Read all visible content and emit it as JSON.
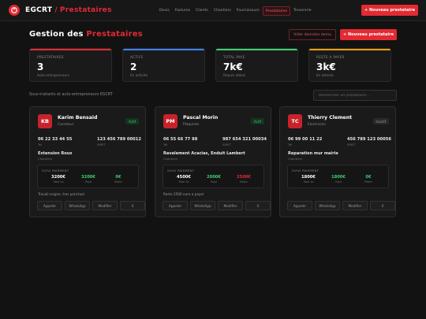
{
  "brand": {
    "name": "EGCRT",
    "separator": "/",
    "section": "Prestataires"
  },
  "nav": [
    {
      "label": "Devis",
      "active": false
    },
    {
      "label": "Factures",
      "active": false
    },
    {
      "label": "Clients",
      "active": false
    },
    {
      "label": "Chantiers",
      "active": false
    },
    {
      "label": "Fournisseurs",
      "active": false
    },
    {
      "label": "Prestataires",
      "active": true
    },
    {
      "label": "Tresorerie",
      "active": false
    }
  ],
  "topbar": {
    "new_button": "+ Nouveau prestataire"
  },
  "header": {
    "title_part1": "Gestion des",
    "title_part2": "Prestataires",
    "demo_button": "Vider données demo",
    "new_button": "+ Nouveau prestataire"
  },
  "stats": [
    {
      "label": "PRESTATAIRES",
      "value": "3",
      "sub": "Auto-entrepreneurs",
      "color": "#e32a32"
    },
    {
      "label": "ACTIFS",
      "value": "2",
      "sub": "En activite",
      "color": "#3b82f6"
    },
    {
      "label": "TOTAL PAYE",
      "value": "7k€",
      "sub": "Depuis debut",
      "color": "#3ecf6f"
    },
    {
      "label": "RESTE A PAYER",
      "value": "3k€",
      "sub": "En attente",
      "color": "#f59e0b"
    }
  ],
  "section": {
    "label": "Sous-traitants et auto-entrepreneurs EGCRT"
  },
  "search": {
    "placeholder": "Rechercher un prestataire..."
  },
  "cards": [
    {
      "initials": "KB",
      "name": "Karim Bensaid",
      "trade": "Carreleur",
      "status": "Actif",
      "status_class": "actif",
      "phone": "06 22 33 44 55",
      "phone_label": "Tel",
      "siret": "123 456 789 00012",
      "siret_label": "SIRET",
      "site": "Extension Roux",
      "site_label": "Chantiers",
      "pay_title": "SUIVI PAIEMENT",
      "total": "3200€",
      "paid": "3200€",
      "rest": "0€",
      "total_label": "Total du",
      "paid_label": "Paye",
      "rest_label": "Reste",
      "note": "Travail soigne, tres ponctuel",
      "actions": [
        "Appeler",
        "WhatsApp",
        "Modifier",
        "X"
      ]
    },
    {
      "initials": "PM",
      "name": "Pascal Morin",
      "trade": "Plaquiste",
      "status": "Actif",
      "status_class": "actif",
      "phone": "06 55 66 77 88",
      "phone_label": "Tel",
      "siret": "987 654 321 00034",
      "siret_label": "SIRET",
      "site": "Ravalement Acacias, Enduit Lambert",
      "site_label": "Chantiers",
      "pay_title": "SUIVI PAIEMENT",
      "total": "4500€",
      "paid": "2000€",
      "rest": "2500€",
      "total_label": "Total du",
      "paid_label": "Paye",
      "rest_label": "Reste",
      "note": "Reste 2500 euro a payer",
      "actions": [
        "Appeler",
        "WhatsApp",
        "Modifier",
        "X"
      ]
    },
    {
      "initials": "TC",
      "name": "Thierry Clement",
      "trade": "Electricien",
      "status": "Inactif",
      "status_class": "inactif",
      "phone": "06 99 00 11 22",
      "phone_label": "Tel",
      "siret": "456 789 123 00056",
      "siret_label": "SIRET",
      "site": "Reparation mur mairie",
      "site_label": "Chantiers",
      "pay_title": "SUIVI PAIEMENT",
      "total": "1800€",
      "paid": "1800€",
      "rest": "0€",
      "total_label": "Total du",
      "paid_label": "Paye",
      "rest_label": "Reste",
      "note": "",
      "actions": [
        "Appeler",
        "WhatsApp",
        "Modifier",
        "X"
      ]
    }
  ],
  "colors": {
    "accent": "#e32a32",
    "paid": "#3ecf6f",
    "rest_zero": "#3ecf6f",
    "rest_due": "#e32a32"
  }
}
